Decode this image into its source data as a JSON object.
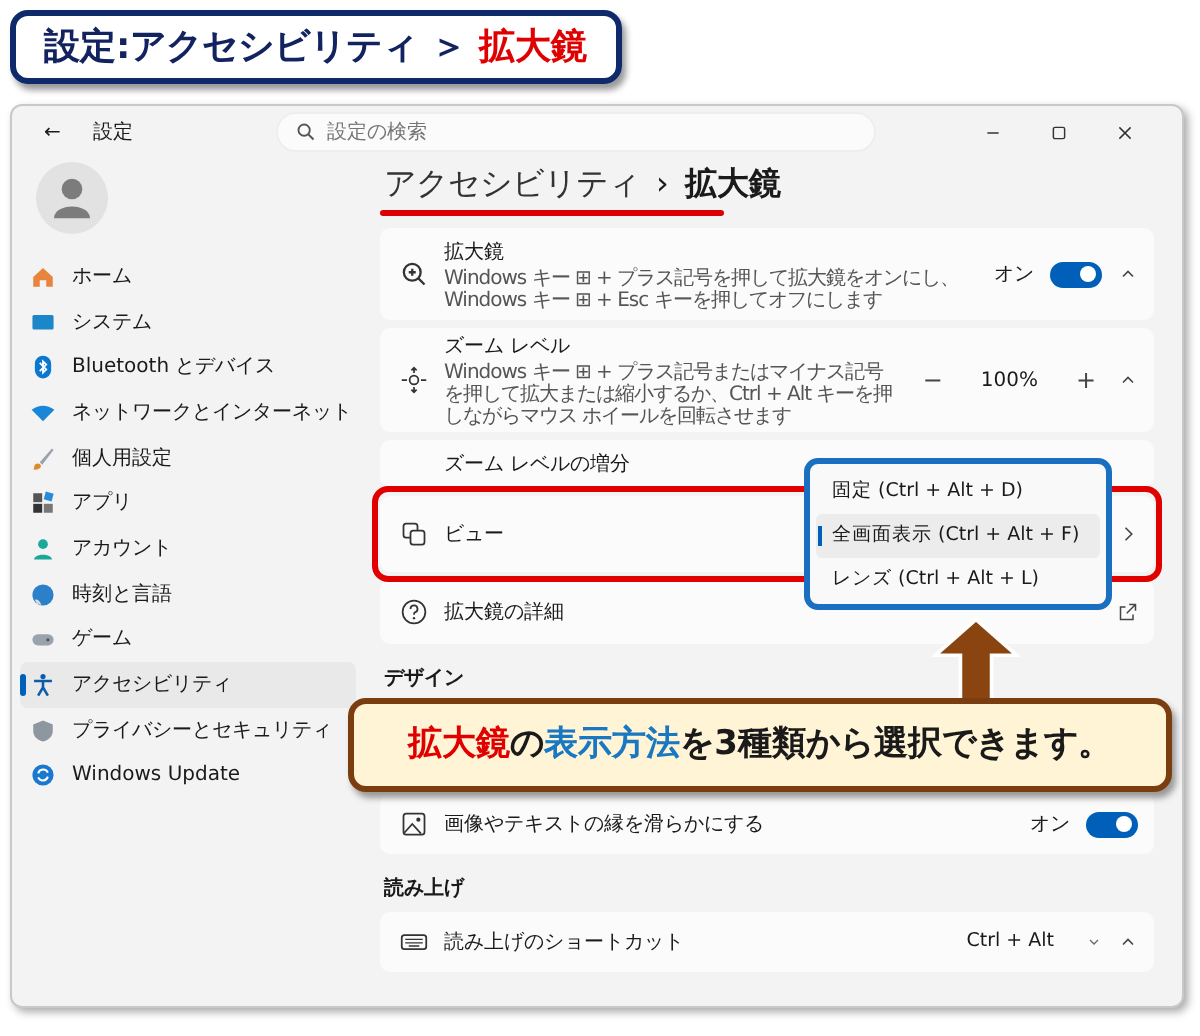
{
  "banner": {
    "segments": [
      {
        "text": "設定:アクセシビリティ ＞ ",
        "kind": "plain"
      },
      {
        "text": "拡大鏡",
        "kind": "subject"
      }
    ]
  },
  "window": {
    "title": "設定",
    "back": "←",
    "search": {
      "placeholder": "設定の検索"
    }
  },
  "sidebar": {
    "items": [
      {
        "label": "ホーム",
        "selected": false
      },
      {
        "label": "システム",
        "selected": false
      },
      {
        "label": "Bluetooth とデバイス",
        "selected": false
      },
      {
        "label": "ネットワークとインターネット",
        "selected": false
      },
      {
        "label": "個人用設定",
        "selected": false
      },
      {
        "label": "アプリ",
        "selected": false
      },
      {
        "label": "アカウント",
        "selected": false
      },
      {
        "label": "時刻と言語",
        "selected": false
      },
      {
        "label": "ゲーム",
        "selected": false
      },
      {
        "label": "アクセシビリティ",
        "selected": true
      },
      {
        "label": "プライバシーとセキュリティ",
        "selected": false
      },
      {
        "label": "Windows Update",
        "selected": false
      }
    ]
  },
  "breadcrumb": {
    "parent": "アクセシビリティ",
    "separator": "›",
    "current": "拡大鏡"
  },
  "sections": [
    {
      "rows": [
        {
          "kind": "toggle",
          "title": "拡大鏡",
          "description": "Windows キー ⊞ + プラス記号を押して拡大鏡をオンにし、Windows キー ⊞ + Esc キーを押してオフにします",
          "state_label": "オン",
          "on": true,
          "expanded": true
        },
        {
          "kind": "stepper",
          "title": "ズーム レベル",
          "description": "Windows キー ⊞ + プラス記号またはマイナス記号を押して拡大または縮小するか、Ctrl + Alt キーを押しながらマウス ホイールを回転させます",
          "minus": "−",
          "value": "100%",
          "plus": "+",
          "expanded": true
        },
        {
          "kind": "plain",
          "title": "ズーム レベルの増分"
        },
        {
          "kind": "nav",
          "title": "ビュー",
          "highlighted": true
        },
        {
          "kind": "link",
          "title": "拡大鏡の詳細"
        }
      ]
    },
    {
      "heading": "デザイン",
      "rows": [
        {
          "kind": "toggle",
          "title": "画像やテキストの縁を滑らかにする",
          "state_label": "オン",
          "on": true,
          "expanded": false
        }
      ]
    },
    {
      "heading": "読み上げ",
      "rows": [
        {
          "kind": "dropdown",
          "title": "読み上げのショートカット",
          "value": "Ctrl + Alt",
          "expanded": true
        }
      ]
    }
  ],
  "view_menu": {
    "options": [
      {
        "label": "固定 (Ctrl + Alt + D)",
        "selected": false
      },
      {
        "label": "全画面表示 (Ctrl + Alt + F)",
        "selected": true
      },
      {
        "label": "レンズ (Ctrl + Alt + L)",
        "selected": false
      }
    ]
  },
  "callout": {
    "segments": [
      {
        "text": "拡大鏡",
        "kind": "subject"
      },
      {
        "text": "の",
        "kind": "plain"
      },
      {
        "text": "表示方法",
        "kind": "method"
      },
      {
        "text": "を3種類から選択できます。",
        "kind": "plain"
      }
    ]
  }
}
